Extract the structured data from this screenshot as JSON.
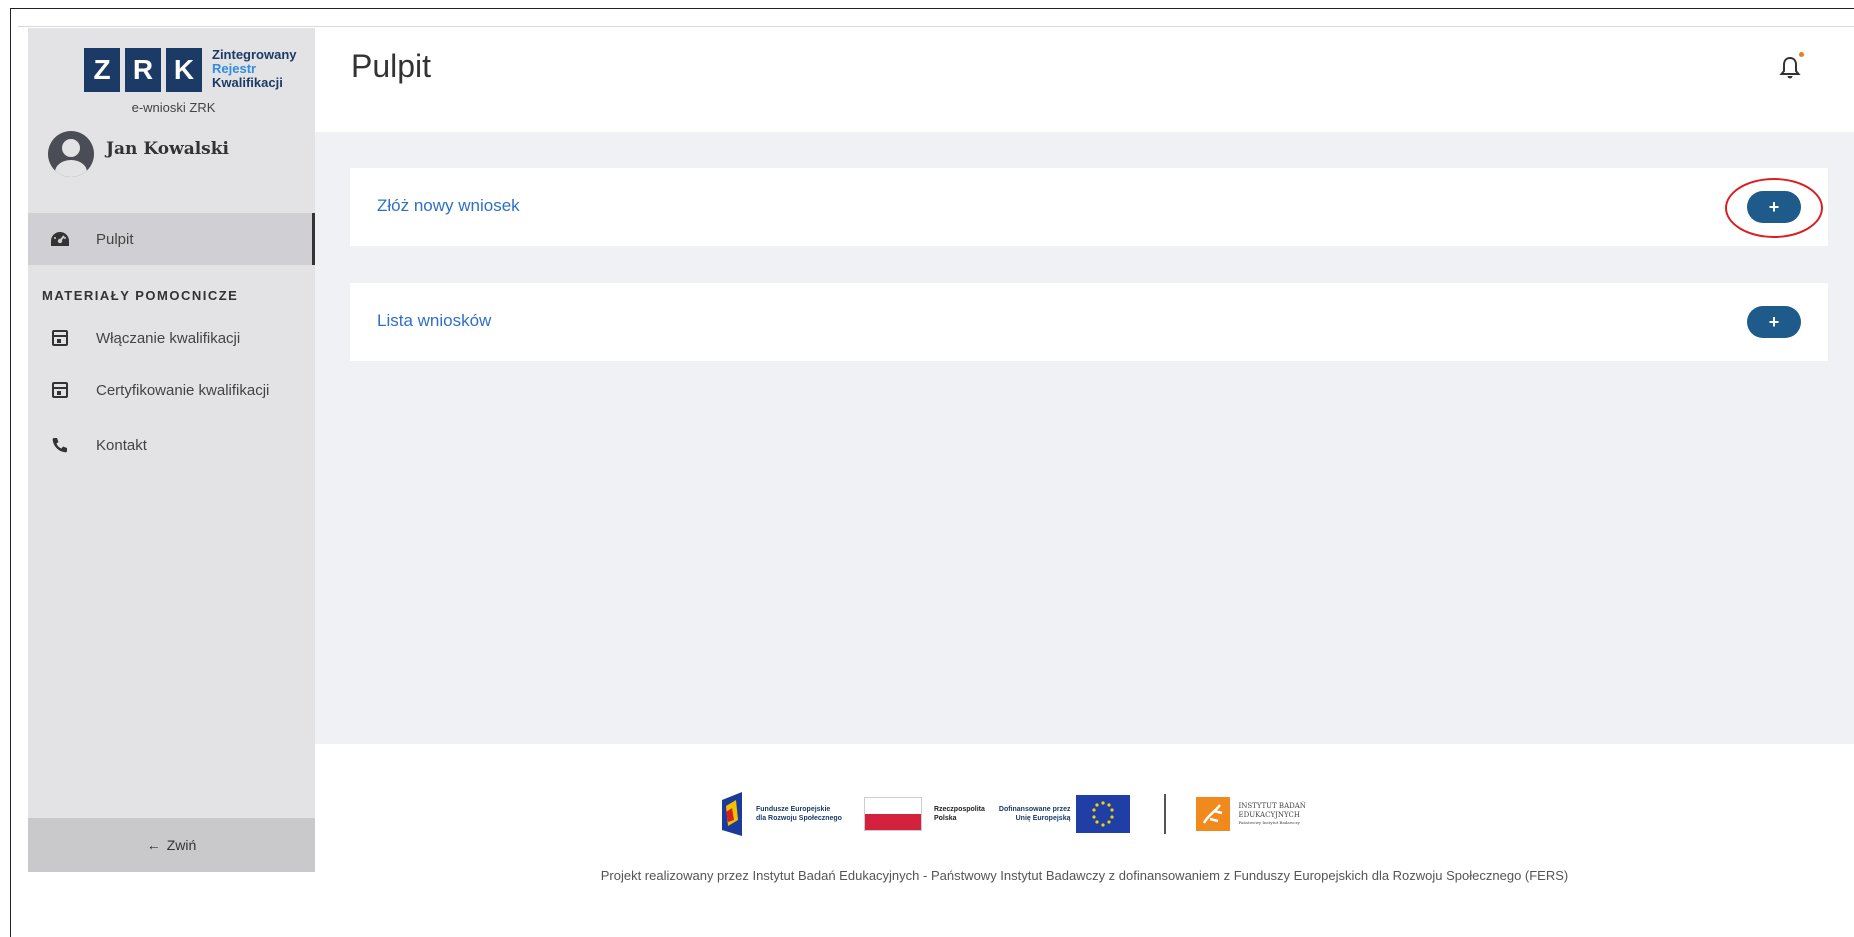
{
  "logo": {
    "letters": [
      "Z",
      "R",
      "K"
    ],
    "line1": "Zintegrowany",
    "line2": "Rejestr",
    "line3": "Kwalifikacji",
    "subtitle": "e-wnioski ZRK"
  },
  "user": {
    "name": "Jan Kowalski"
  },
  "sidebar": {
    "active_item": {
      "label": "Pulpit",
      "icon": "dashboard-icon"
    },
    "section_title": "MATERIAŁY POMOCNICZE",
    "items": [
      {
        "label": "Włączanie kwalifikacji",
        "icon": "calendar-icon"
      },
      {
        "label": "Certyfikowanie kwalifikacji",
        "icon": "calendar-icon"
      },
      {
        "label": "Kontakt",
        "icon": "phone-icon"
      }
    ],
    "collapse_label": "Zwiń"
  },
  "header": {
    "title": "Pulpit",
    "notification_icon": "bell-icon"
  },
  "cards": [
    {
      "label": "Złóż nowy wniosek",
      "button": "+"
    },
    {
      "label": "Lista wniosków",
      "button": "+"
    }
  ],
  "footer": {
    "logos": {
      "fe_line1": "Fundusze Europejskie",
      "fe_line2": "dla Rozwoju Społecznego",
      "rp_line1": "Rzeczpospolita",
      "rp_line2": "Polska",
      "eu_line1": "Dofinansowane przez",
      "eu_line2": "Unię Europejską",
      "ibe_line1": "INSTYTUT BADAŃ",
      "ibe_line2": "EDUKACYJNYCH",
      "ibe_line3": "Państwowy Instytut Badawczy"
    },
    "text": "Projekt realizowany przez Instytut Badań Edukacyjnych - Państwowy Instytut Badawczy z dofinansowaniem z Funduszy Europejskich dla Rozwoju Społecznego (FERS)"
  },
  "colors": {
    "sidebar_bg": "#e3e3e5",
    "content_bg": "#eff1f4",
    "link": "#2f6fc8",
    "button": "#1e5a8a",
    "highlight": "#d92020"
  }
}
